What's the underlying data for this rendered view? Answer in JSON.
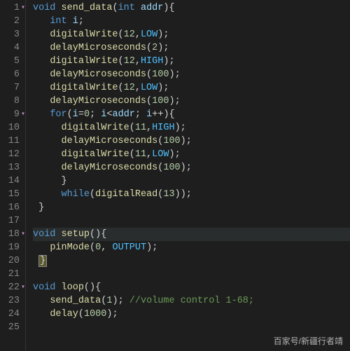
{
  "watermark": "百家号/新疆行者靖",
  "highlighted_line_index": 17,
  "lines": [
    {
      "n": 1,
      "fold": true,
      "tokens": [
        [
          "kw",
          "void"
        ],
        [
          "op",
          " "
        ],
        [
          "fn",
          "send_data"
        ],
        [
          "pun",
          "("
        ],
        [
          "type",
          "int"
        ],
        [
          "op",
          " "
        ],
        [
          "ident",
          "addr"
        ],
        [
          "pun",
          ")"
        ],
        [
          "pun",
          "{"
        ]
      ]
    },
    {
      "n": 2,
      "fold": false,
      "tokens": [
        [
          "op",
          "   "
        ],
        [
          "type",
          "int"
        ],
        [
          "op",
          " "
        ],
        [
          "ident",
          "i"
        ],
        [
          "pun",
          ";"
        ]
      ]
    },
    {
      "n": 3,
      "fold": false,
      "tokens": [
        [
          "op",
          "   "
        ],
        [
          "fn",
          "digitalWrite"
        ],
        [
          "pun",
          "("
        ],
        [
          "num",
          "12"
        ],
        [
          "pun",
          ","
        ],
        [
          "const",
          "LOW"
        ],
        [
          "pun",
          ")"
        ],
        [
          "pun",
          ";"
        ]
      ]
    },
    {
      "n": 4,
      "fold": false,
      "tokens": [
        [
          "op",
          "   "
        ],
        [
          "fn",
          "delayMicroseconds"
        ],
        [
          "pun",
          "("
        ],
        [
          "num",
          "2"
        ],
        [
          "pun",
          ")"
        ],
        [
          "pun",
          ";"
        ]
      ]
    },
    {
      "n": 5,
      "fold": false,
      "tokens": [
        [
          "op",
          "   "
        ],
        [
          "fn",
          "digitalWrite"
        ],
        [
          "pun",
          "("
        ],
        [
          "num",
          "12"
        ],
        [
          "pun",
          ","
        ],
        [
          "const",
          "HIGH"
        ],
        [
          "pun",
          ")"
        ],
        [
          "pun",
          ";"
        ]
      ]
    },
    {
      "n": 6,
      "fold": false,
      "tokens": [
        [
          "op",
          "   "
        ],
        [
          "fn",
          "delayMicroseconds"
        ],
        [
          "pun",
          "("
        ],
        [
          "num",
          "100"
        ],
        [
          "pun",
          ")"
        ],
        [
          "pun",
          ";"
        ]
      ]
    },
    {
      "n": 7,
      "fold": false,
      "tokens": [
        [
          "op",
          "   "
        ],
        [
          "fn",
          "digitalWrite"
        ],
        [
          "pun",
          "("
        ],
        [
          "num",
          "12"
        ],
        [
          "pun",
          ","
        ],
        [
          "const",
          "LOW"
        ],
        [
          "pun",
          ")"
        ],
        [
          "pun",
          ";"
        ]
      ]
    },
    {
      "n": 8,
      "fold": false,
      "tokens": [
        [
          "op",
          "   "
        ],
        [
          "fn",
          "delayMicroseconds"
        ],
        [
          "pun",
          "("
        ],
        [
          "num",
          "100"
        ],
        [
          "pun",
          ")"
        ],
        [
          "pun",
          ";"
        ]
      ]
    },
    {
      "n": 9,
      "fold": true,
      "tokens": [
        [
          "op",
          "   "
        ],
        [
          "kw",
          "for"
        ],
        [
          "pun",
          "("
        ],
        [
          "ident",
          "i"
        ],
        [
          "op",
          "="
        ],
        [
          "num",
          "0"
        ],
        [
          "pun",
          ";"
        ],
        [
          "op",
          " "
        ],
        [
          "ident",
          "i"
        ],
        [
          "op",
          "<"
        ],
        [
          "ident",
          "addr"
        ],
        [
          "pun",
          ";"
        ],
        [
          "op",
          " "
        ],
        [
          "ident",
          "i"
        ],
        [
          "op",
          "++"
        ],
        [
          "pun",
          ")"
        ],
        [
          "pun",
          "{"
        ]
      ]
    },
    {
      "n": 10,
      "fold": false,
      "tokens": [
        [
          "op",
          "     "
        ],
        [
          "fn",
          "digitalWrite"
        ],
        [
          "pun",
          "("
        ],
        [
          "num",
          "11"
        ],
        [
          "pun",
          ","
        ],
        [
          "const",
          "HIGH"
        ],
        [
          "pun",
          ")"
        ],
        [
          "pun",
          ";"
        ]
      ]
    },
    {
      "n": 11,
      "fold": false,
      "tokens": [
        [
          "op",
          "     "
        ],
        [
          "fn",
          "delayMicroseconds"
        ],
        [
          "pun",
          "("
        ],
        [
          "num",
          "100"
        ],
        [
          "pun",
          ")"
        ],
        [
          "pun",
          ";"
        ]
      ]
    },
    {
      "n": 12,
      "fold": false,
      "tokens": [
        [
          "op",
          "     "
        ],
        [
          "fn",
          "digitalWrite"
        ],
        [
          "pun",
          "("
        ],
        [
          "num",
          "11"
        ],
        [
          "pun",
          ","
        ],
        [
          "const",
          "LOW"
        ],
        [
          "pun",
          ")"
        ],
        [
          "pun",
          ";"
        ]
      ]
    },
    {
      "n": 13,
      "fold": false,
      "tokens": [
        [
          "op",
          "     "
        ],
        [
          "fn",
          "delayMicroseconds"
        ],
        [
          "pun",
          "("
        ],
        [
          "num",
          "100"
        ],
        [
          "pun",
          ")"
        ],
        [
          "pun",
          ";"
        ]
      ]
    },
    {
      "n": 14,
      "fold": false,
      "tokens": [
        [
          "op",
          "     "
        ],
        [
          "pun",
          "}"
        ]
      ]
    },
    {
      "n": 15,
      "fold": false,
      "tokens": [
        [
          "op",
          "     "
        ],
        [
          "kw",
          "while"
        ],
        [
          "pun",
          "("
        ],
        [
          "fn",
          "digitalRead"
        ],
        [
          "pun",
          "("
        ],
        [
          "num",
          "13"
        ],
        [
          "pun",
          ")"
        ],
        [
          "pun",
          ")"
        ],
        [
          "pun",
          ";"
        ]
      ]
    },
    {
      "n": 16,
      "fold": false,
      "tokens": [
        [
          "op",
          " "
        ],
        [
          "pun",
          "}"
        ]
      ]
    },
    {
      "n": 17,
      "fold": false,
      "tokens": []
    },
    {
      "n": 18,
      "fold": true,
      "tokens": [
        [
          "kw",
          "void"
        ],
        [
          "op",
          " "
        ],
        [
          "fn",
          "setup"
        ],
        [
          "pun",
          "("
        ],
        [
          "pun",
          ")"
        ],
        [
          "pun",
          "{"
        ]
      ]
    },
    {
      "n": 19,
      "fold": false,
      "tokens": [
        [
          "op",
          "   "
        ],
        [
          "fn",
          "pinMode"
        ],
        [
          "pun",
          "("
        ],
        [
          "num",
          "0"
        ],
        [
          "pun",
          ","
        ],
        [
          "op",
          " "
        ],
        [
          "const",
          "OUTPUT"
        ],
        [
          "pun",
          ")"
        ],
        [
          "pun",
          ";"
        ]
      ]
    },
    {
      "n": 20,
      "fold": false,
      "tokens": [
        [
          "op",
          " "
        ],
        [
          "brace",
          "}"
        ]
      ]
    },
    {
      "n": 21,
      "fold": false,
      "tokens": []
    },
    {
      "n": 22,
      "fold": true,
      "tokens": [
        [
          "kw",
          "void"
        ],
        [
          "op",
          " "
        ],
        [
          "fn",
          "loop"
        ],
        [
          "pun",
          "("
        ],
        [
          "pun",
          ")"
        ],
        [
          "pun",
          "{"
        ]
      ]
    },
    {
      "n": 23,
      "fold": false,
      "tokens": [
        [
          "op",
          "   "
        ],
        [
          "fn",
          "send_data"
        ],
        [
          "pun",
          "("
        ],
        [
          "num",
          "1"
        ],
        [
          "pun",
          ")"
        ],
        [
          "pun",
          ";"
        ],
        [
          "op",
          " "
        ],
        [
          "cmt",
          "//volume control 1-68;"
        ]
      ]
    },
    {
      "n": 24,
      "fold": false,
      "tokens": [
        [
          "op",
          "   "
        ],
        [
          "fn",
          "delay"
        ],
        [
          "pun",
          "("
        ],
        [
          "num",
          "1000"
        ],
        [
          "pun",
          ")"
        ],
        [
          "pun",
          ";"
        ]
      ]
    },
    {
      "n": 25,
      "fold": false,
      "tokens": []
    }
  ]
}
